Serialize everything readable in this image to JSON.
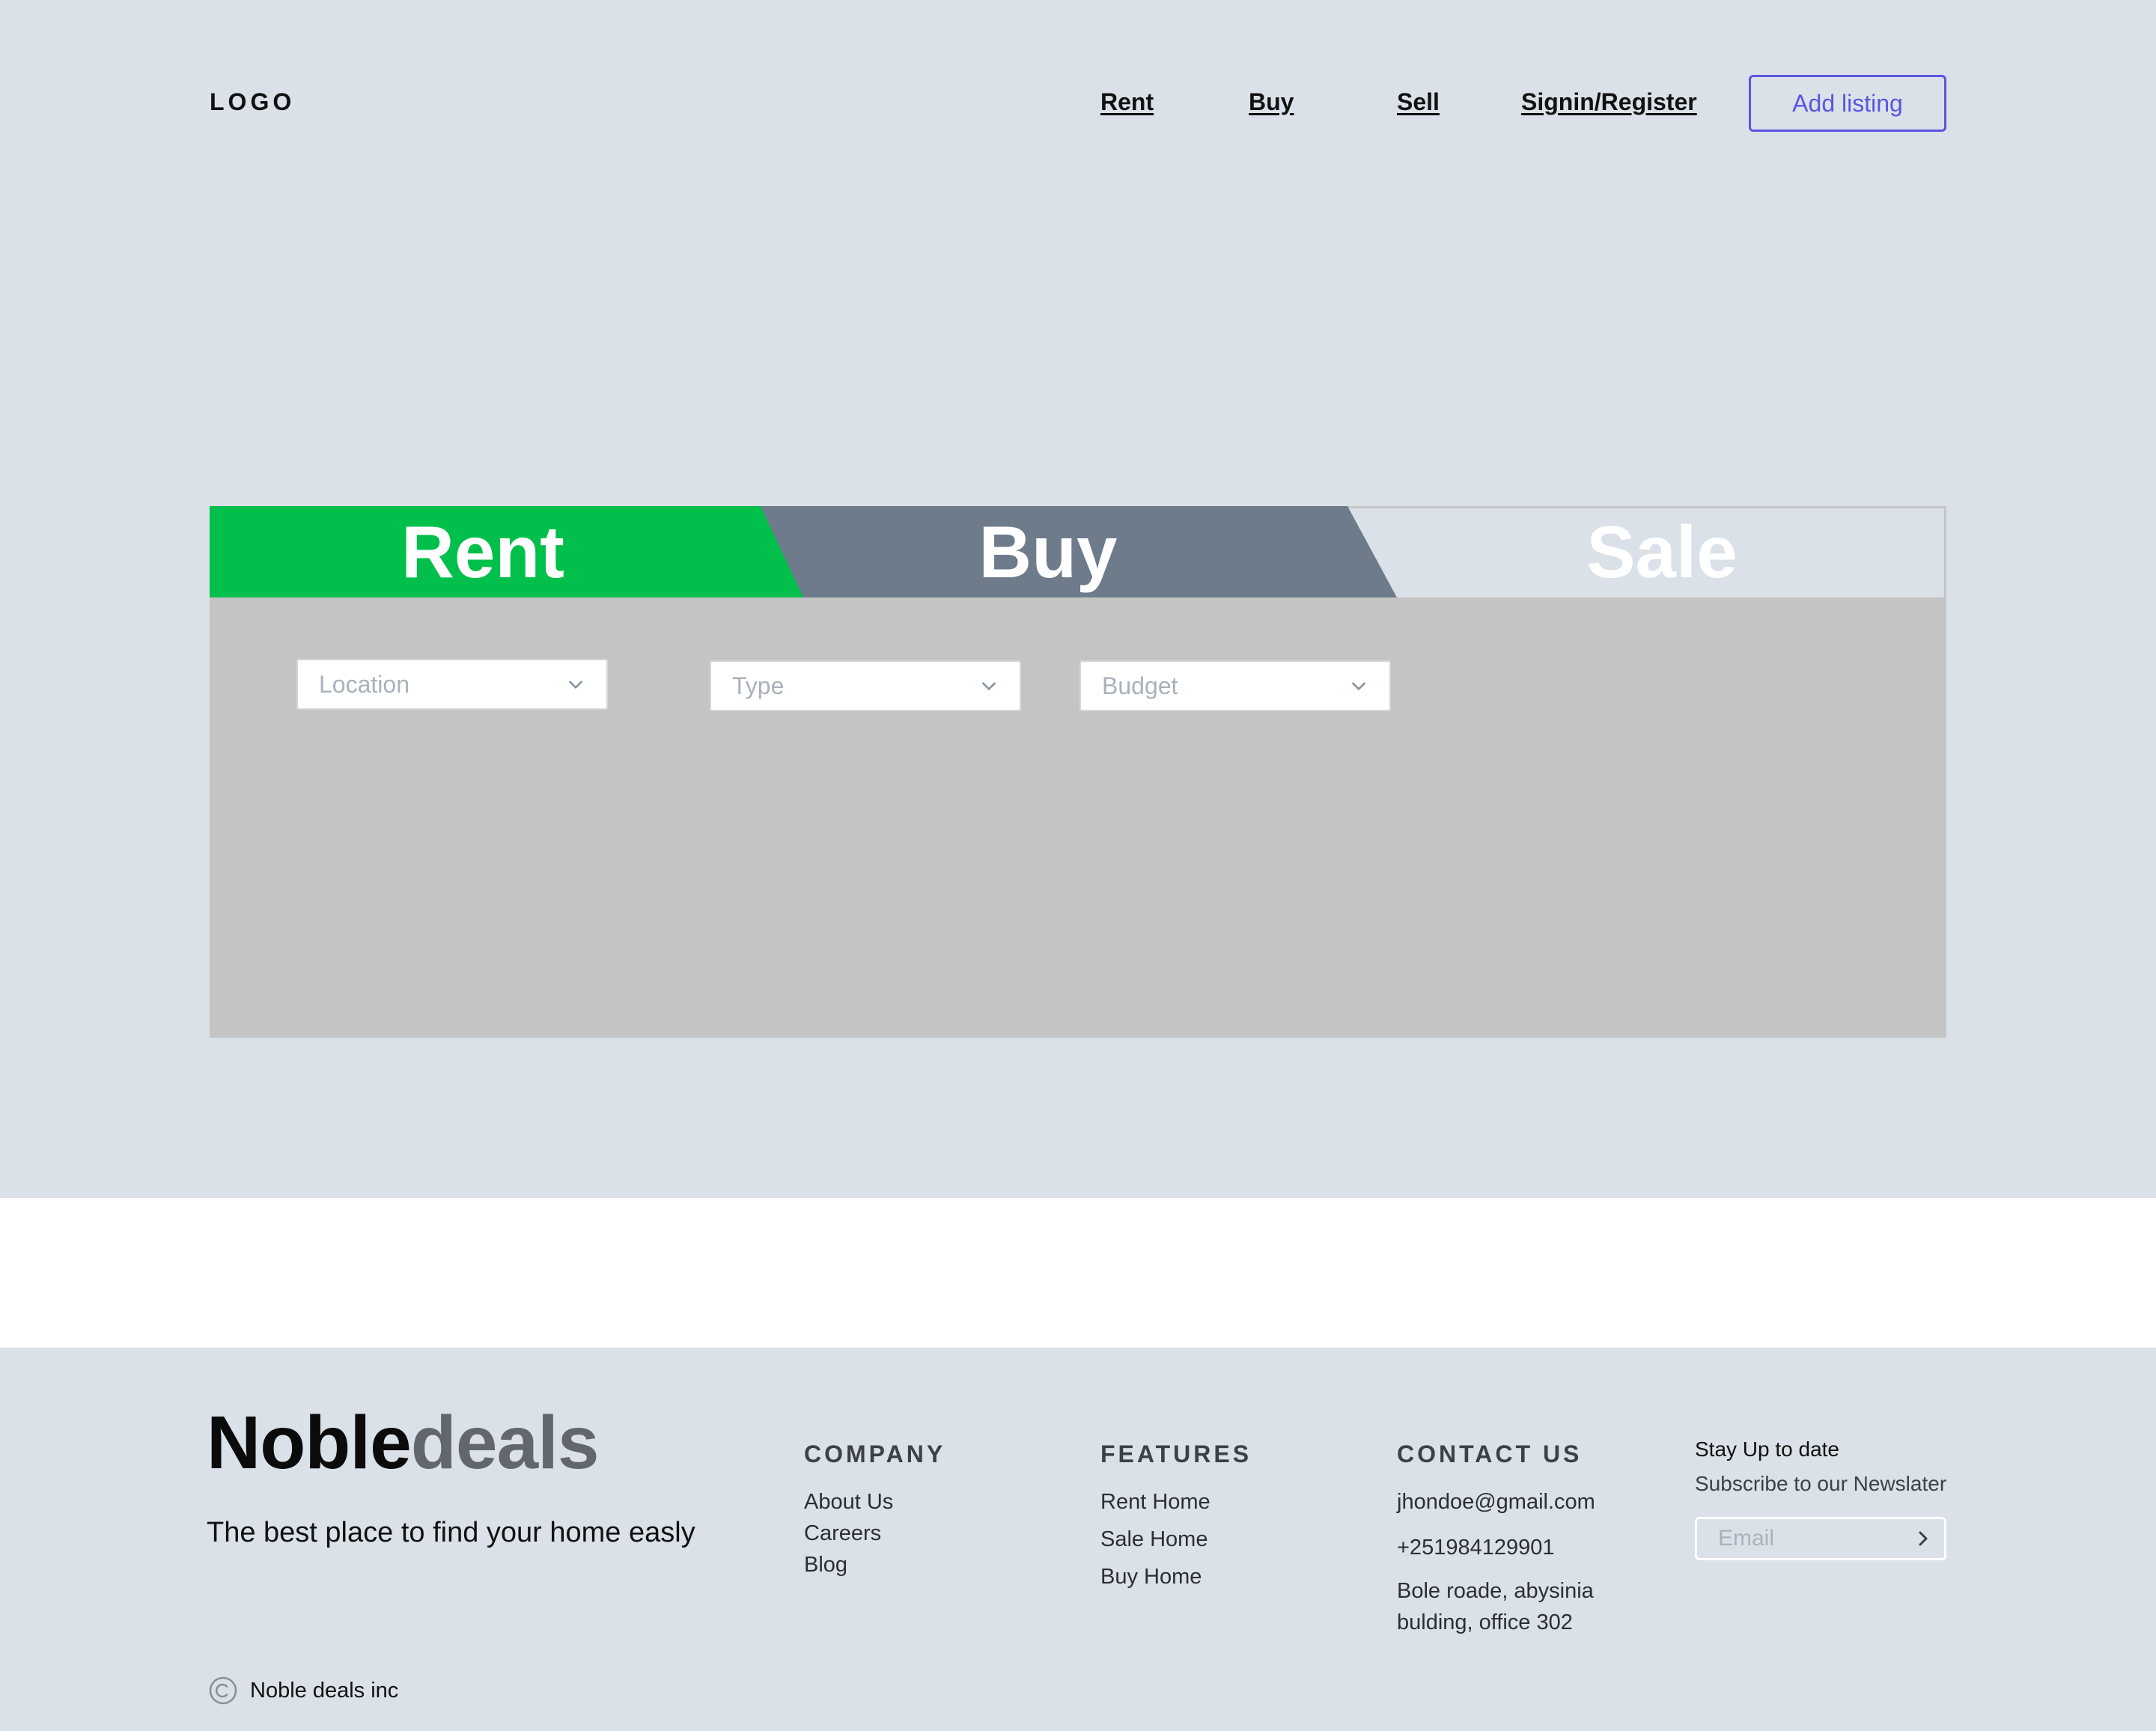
{
  "header": {
    "logo": "LOGO",
    "nav": {
      "rent": "Rent",
      "buy": "Buy",
      "sell": "Sell",
      "signin": "Signin/Register"
    },
    "add_listing": "Add listing",
    "accent_color": "#5a55e0"
  },
  "search": {
    "tabs": {
      "rent": "Rent",
      "buy": "Buy",
      "sale": "Sale"
    },
    "tab_colors": {
      "rent": "#00c04b",
      "buy": "#6d7b8a",
      "sale": "#dae1e8"
    },
    "filters": {
      "location": "Location",
      "type": "Type",
      "budget": "Budget"
    }
  },
  "footer": {
    "brand": {
      "part1": "Noble",
      "part2": "deals"
    },
    "tagline": "The best place to find your home easly",
    "company": {
      "title": "COMPANY",
      "links": [
        "About Us",
        "Careers",
        "Blog"
      ]
    },
    "features": {
      "title": "FEATURES",
      "links": [
        "Rent Home",
        "Sale Home",
        "Buy Home"
      ]
    },
    "contact": {
      "title": "CONTACT US",
      "email": "jhondoe@gmail.com",
      "phone": "+251984129901",
      "address_line1": "Bole roade, abysinia",
      "address_line2": "bulding, office 302"
    },
    "newsletter": {
      "title": "Stay Up to date",
      "subtitle": "Subscribe to our Newslater",
      "placeholder": "Email"
    },
    "copyright": "Noble deals inc"
  }
}
